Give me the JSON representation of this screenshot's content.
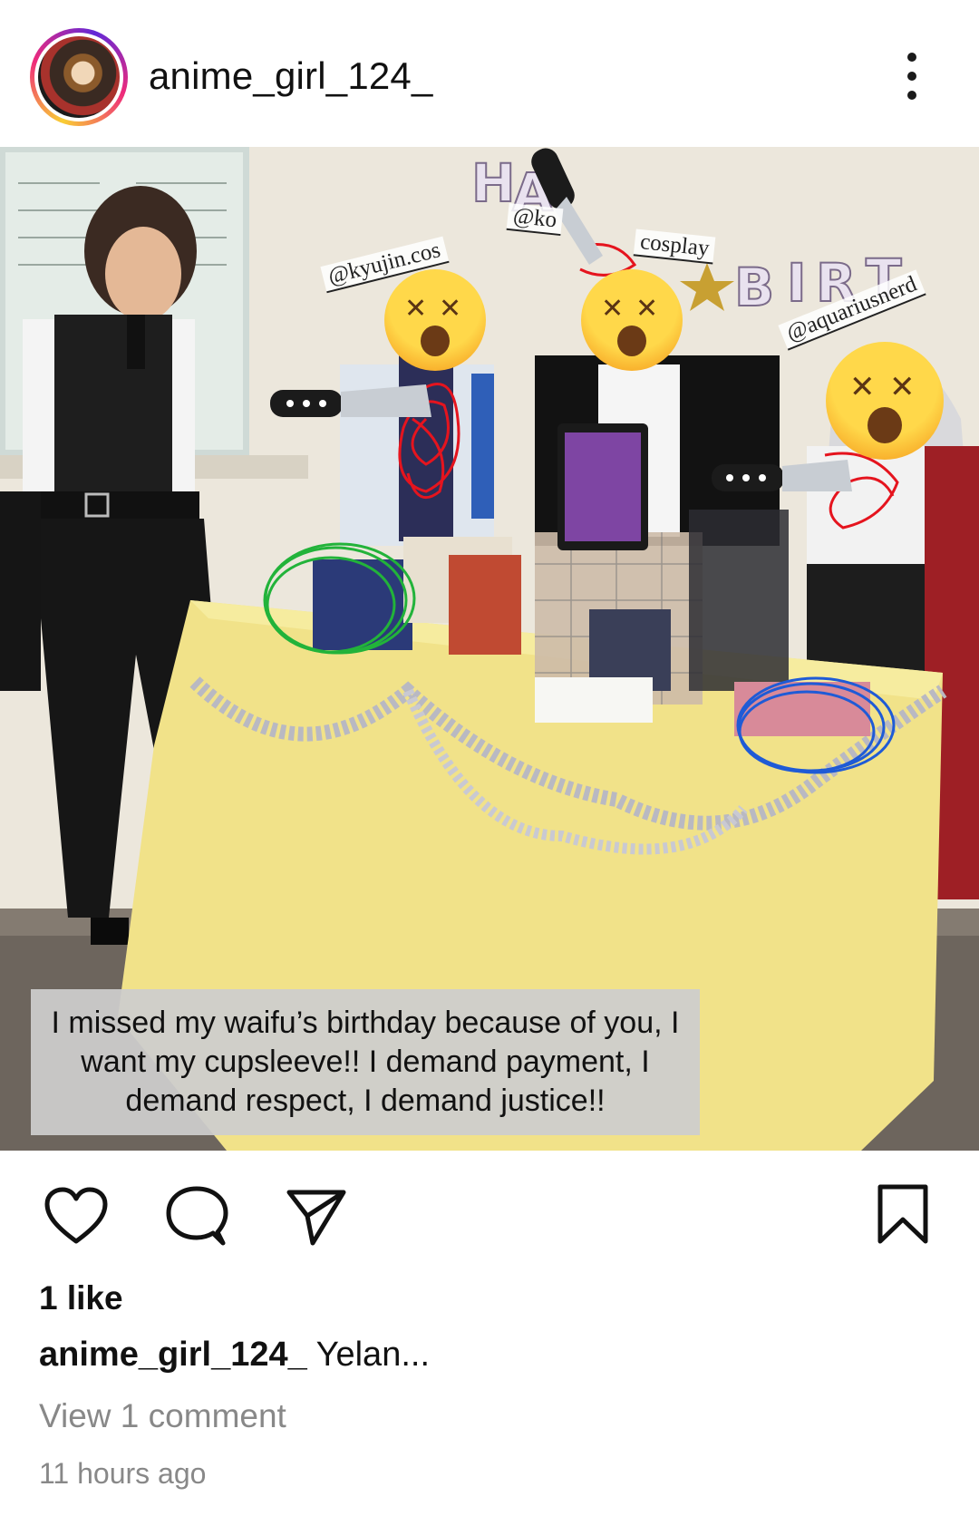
{
  "header": {
    "username": "anime_girl_124_"
  },
  "photo": {
    "tags": [
      "@kyujin.cos",
      "@ko",
      "cosplay",
      "@aquariusnerd"
    ],
    "banner": "HAPPY BIRTHDAY",
    "overlay_text": "I missed my waifu’s birthday because of you, I want my cupsleeve!! I demand payment, I demand respect, I demand justice!!"
  },
  "actions": {
    "like_icon": "heart-icon",
    "comment_icon": "comment-icon",
    "share_icon": "send-icon",
    "save_icon": "bookmark-icon"
  },
  "post": {
    "likes": "1 like",
    "caption_user": "anime_girl_124_",
    "caption_text": " Yelan...",
    "view_comments": "View 1 comment",
    "timestamp": "11 hours ago"
  },
  "colors": {
    "text": "#111111",
    "muted": "#888888",
    "tablecloth": "#f2e38a",
    "scribble_red": "#e5141e",
    "circle_green": "#22b33a",
    "circle_blue": "#1f5bd6"
  }
}
